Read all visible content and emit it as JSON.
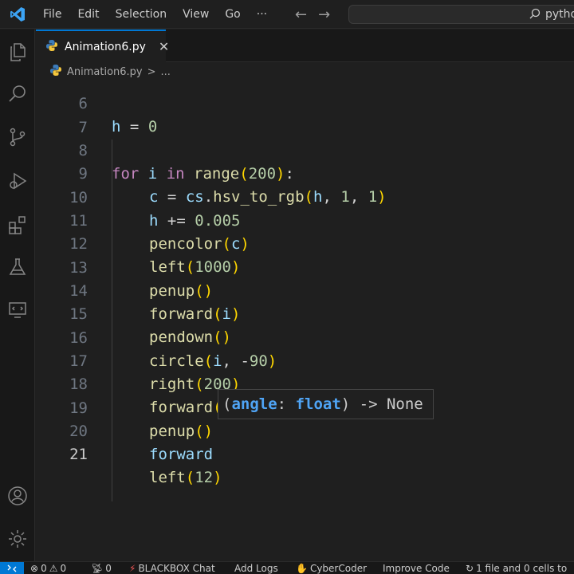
{
  "menu": [
    "File",
    "Edit",
    "Selection",
    "View",
    "Go",
    "···"
  ],
  "nav": {
    "back": "←",
    "forward": "→"
  },
  "search": {
    "text": "python"
  },
  "activity_bar": {
    "icons": [
      "explorer-icon",
      "search-icon",
      "source-control-icon",
      "run-debug-icon",
      "extensions-icon",
      "testing-icon",
      "remote-explorer-icon"
    ],
    "bottom_icons": [
      "account-icon",
      "settings-gear-icon"
    ]
  },
  "tab": {
    "label": "Animation6.py",
    "close": "✕"
  },
  "breadcrumb": {
    "file": "Animation6.py",
    "sep": ">",
    "more": "..."
  },
  "editor": {
    "lines": [
      {
        "n": "6",
        "text": "h = 0"
      },
      {
        "n": "7",
        "text": ""
      },
      {
        "n": "8",
        "text": "for i in range(200):"
      },
      {
        "n": "9",
        "text": "c = cs.hsv_to_rgb(h, 1, 1)"
      },
      {
        "n": "10",
        "text": "h += 0.005"
      },
      {
        "n": "11",
        "text": "pencolor(c)"
      },
      {
        "n": "12",
        "text": "left(1000)"
      },
      {
        "n": "13",
        "text": "penup()"
      },
      {
        "n": "14",
        "text": "forward(i)"
      },
      {
        "n": "15",
        "text": "pendown()"
      },
      {
        "n": "16",
        "text": "circle(i, -90)"
      },
      {
        "n": "17",
        "text": "right(200)"
      },
      {
        "n": "18",
        "text": "forward(i)"
      },
      {
        "n": "19",
        "text": "penup()"
      },
      {
        "n": "20",
        "text": "forward"
      },
      {
        "n": "21",
        "text": "left(12)"
      }
    ],
    "active_line": "21"
  },
  "signature_hint": {
    "param_name": "angle",
    "colon": ":",
    "param_type": "float",
    "suffix": ") -> None",
    "open": "("
  },
  "status_bar": {
    "errors": "0",
    "warnings": "0",
    "ports": "0",
    "blackbox": "BLACKBOX Chat",
    "add_logs": "Add Logs",
    "cybercoder": "CyberCoder",
    "improve_code": "Improve Code",
    "cells": "1 file and 0 cells to"
  },
  "colors": {
    "accent": "#0078d4",
    "background": "#1f1f1f",
    "sidebar": "#181818"
  }
}
